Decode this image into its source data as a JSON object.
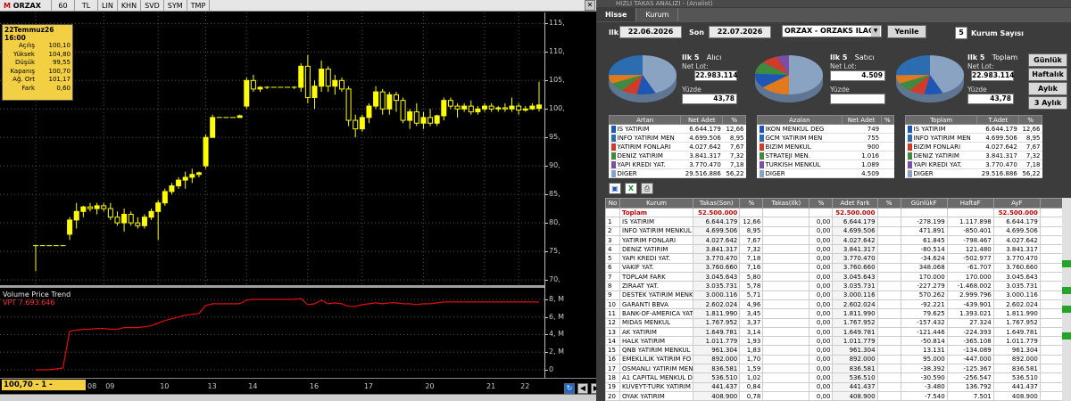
{
  "chart": {
    "symbol": "ORZAX",
    "tb_interval": "60",
    "tb_tl": "TL",
    "tb_modes": [
      "LIN",
      "KHN",
      "SVD",
      "SYM",
      "TMP"
    ],
    "info": {
      "title": "22Temmuz26 16:00",
      "rows": [
        {
          "k": "Açılış",
          "v": "100,10"
        },
        {
          "k": "Yüksek",
          "v": "104,80"
        },
        {
          "k": "Düşük",
          "v": "99,55"
        },
        {
          "k": "Kapanış",
          "v": "100,70"
        },
        {
          "k": "Ağ. Ort",
          "v": "101,17"
        },
        {
          "k": "Fark",
          "v": "0,60"
        }
      ]
    },
    "yticks": [
      "115,",
      "110,",
      "105,",
      "100,",
      "95,",
      "90,",
      "85,",
      "80,",
      "75,",
      "70,"
    ],
    "vpt_title": "Volume Price Trend",
    "vpt_value": "VPT   7.693.646",
    "vpt_ticks": [
      "8, M",
      "6, M",
      "4, M",
      "2, M",
      "0"
    ],
    "xticks": [
      "08",
      "09",
      "10",
      "13",
      "14",
      "16",
      "17",
      "20",
      "21",
      "22"
    ],
    "status": "100,70 - 1 - 16:33:08"
  },
  "chart_data": {
    "type": "candlestick",
    "title": "ORZAX",
    "ylim": [
      70,
      116
    ],
    "days": [
      "08",
      "09",
      "10",
      "13",
      "14",
      "16",
      "17",
      "20",
      "21",
      "22"
    ],
    "colors": {
      "candle": "#ffff00",
      "vpt": "#e01010",
      "grid": "#555555"
    },
    "candles": [
      {
        "o": 76,
        "h": 76,
        "l": 71.5,
        "c": 76
      },
      {
        "o": 76,
        "h": 76,
        "l": 76,
        "c": 76
      },
      {
        "o": 76,
        "h": 76,
        "l": 76,
        "c": 76
      },
      {
        "o": 76,
        "h": 76,
        "l": 76,
        "c": 76
      },
      {
        "o": 76,
        "h": 76,
        "l": 76,
        "c": 76
      },
      {
        "o": 78,
        "h": 81,
        "l": 77,
        "c": 80.5
      },
      {
        "o": 80.5,
        "h": 83.5,
        "l": 79,
        "c": 82
      },
      {
        "o": 82,
        "h": 83,
        "l": 81,
        "c": 82.8
      },
      {
        "o": 82.8,
        "h": 83.5,
        "l": 82,
        "c": 82.5
      },
      {
        "o": 82.5,
        "h": 83.5,
        "l": 81.5,
        "c": 83
      },
      {
        "o": 83,
        "h": 83.5,
        "l": 82,
        "c": 82.5
      },
      {
        "o": 82.5,
        "h": 83.5,
        "l": 80.5,
        "c": 81
      },
      {
        "o": 81,
        "h": 82,
        "l": 79.5,
        "c": 80
      },
      {
        "o": 80,
        "h": 82.5,
        "l": 78.5,
        "c": 81.5
      },
      {
        "o": 81.5,
        "h": 82,
        "l": 79.5,
        "c": 80
      },
      {
        "o": 80,
        "h": 81,
        "l": 79,
        "c": 79.5
      },
      {
        "o": 79.5,
        "h": 81.5,
        "l": 79,
        "c": 81
      },
      {
        "o": 81,
        "h": 82.5,
        "l": 80.5,
        "c": 82
      },
      {
        "o": 82,
        "h": 84,
        "l": 77,
        "c": 83.5
      },
      {
        "o": 83.5,
        "h": 86,
        "l": 83,
        "c": 85.5
      },
      {
        "o": 85.5,
        "h": 87,
        "l": 85,
        "c": 86.5
      },
      {
        "o": 86.5,
        "h": 88,
        "l": 86,
        "c": 87.5
      },
      {
        "o": 87.5,
        "h": 89,
        "l": 86,
        "c": 88
      },
      {
        "o": 88,
        "h": 89.5,
        "l": 87,
        "c": 88.5
      },
      {
        "o": 88.5,
        "h": 89,
        "l": 88,
        "c": 88.8
      },
      {
        "o": 90,
        "h": 95.5,
        "l": 89.5,
        "c": 95
      },
      {
        "o": 95,
        "h": 99,
        "l": 95,
        "c": 98.5
      },
      {
        "o": 98.5,
        "h": 98.5,
        "l": 98.5,
        "c": 98.5
      },
      {
        "o": 98.5,
        "h": 98.5,
        "l": 98.5,
        "c": 98.5
      },
      {
        "o": 98.5,
        "h": 98.5,
        "l": 98.5,
        "c": 98.5
      },
      {
        "o": 98.5,
        "h": 99,
        "l": 98.5,
        "c": 98.8
      },
      {
        "o": 100.5,
        "h": 105.5,
        "l": 100,
        "c": 105
      },
      {
        "o": 105,
        "h": 106,
        "l": 103,
        "c": 103.5
      },
      {
        "o": 103.5,
        "h": 104,
        "l": 103,
        "c": 103.8
      },
      {
        "o": 103.8,
        "h": 104,
        "l": 103.5,
        "c": 103.8
      },
      {
        "o": 103.8,
        "h": 103.8,
        "l": 103.8,
        "c": 103.8
      },
      {
        "o": 103.8,
        "h": 103.8,
        "l": 103.8,
        "c": 103.8
      },
      {
        "o": 103.8,
        "h": 103.8,
        "l": 103.8,
        "c": 103.8
      },
      {
        "o": 103.8,
        "h": 104,
        "l": 103.5,
        "c": 103.8
      },
      {
        "o": 103.8,
        "h": 108,
        "l": 103,
        "c": 107.5
      },
      {
        "o": 107.5,
        "h": 109.5,
        "l": 101,
        "c": 102
      },
      {
        "o": 102,
        "h": 105,
        "l": 100,
        "c": 104
      },
      {
        "o": 104,
        "h": 108.5,
        "l": 103,
        "c": 107
      },
      {
        "o": 107,
        "h": 107.5,
        "l": 103,
        "c": 104
      },
      {
        "o": 104,
        "h": 106,
        "l": 102.5,
        "c": 105
      },
      {
        "o": 105,
        "h": 105.5,
        "l": 103,
        "c": 103.5
      },
      {
        "o": 103.5,
        "h": 104,
        "l": 97,
        "c": 98
      },
      {
        "o": 98,
        "h": 99,
        "l": 95,
        "c": 96.5
      },
      {
        "o": 96.5,
        "h": 99,
        "l": 96,
        "c": 98.5
      },
      {
        "o": 98.5,
        "h": 101,
        "l": 97.5,
        "c": 100.5
      },
      {
        "o": 100.5,
        "h": 104,
        "l": 100,
        "c": 103
      },
      {
        "o": 103,
        "h": 103.5,
        "l": 99,
        "c": 100
      },
      {
        "o": 100,
        "h": 103,
        "l": 99,
        "c": 102.5
      },
      {
        "o": 102.5,
        "h": 103,
        "l": 99.5,
        "c": 101.5
      },
      {
        "o": 101.5,
        "h": 102,
        "l": 97.5,
        "c": 98
      },
      {
        "o": 98,
        "h": 100,
        "l": 96.5,
        "c": 99.5
      },
      {
        "o": 99.5,
        "h": 101,
        "l": 97,
        "c": 97.5
      },
      {
        "o": 97.5,
        "h": 99.5,
        "l": 96.5,
        "c": 98.5
      },
      {
        "o": 98.5,
        "h": 100,
        "l": 97,
        "c": 97.5
      },
      {
        "o": 97.5,
        "h": 99,
        "l": 97,
        "c": 98.8
      },
      {
        "o": 98.8,
        "h": 102,
        "l": 98,
        "c": 101.5
      },
      {
        "o": 101.5,
        "h": 102,
        "l": 100,
        "c": 100.5
      },
      {
        "o": 100.5,
        "h": 101,
        "l": 98.5,
        "c": 100
      },
      {
        "o": 100,
        "h": 101,
        "l": 99.5,
        "c": 100.5
      },
      {
        "o": 100.5,
        "h": 101.5,
        "l": 99,
        "c": 99.5
      },
      {
        "o": 99.5,
        "h": 100.5,
        "l": 99,
        "c": 100
      },
      {
        "o": 100,
        "h": 101,
        "l": 99.5,
        "c": 100.5
      },
      {
        "o": 100.5,
        "h": 101,
        "l": 99.5,
        "c": 100
      },
      {
        "o": 100,
        "h": 100.5,
        "l": 99.5,
        "c": 100.2
      },
      {
        "o": 100.2,
        "h": 101,
        "l": 99.5,
        "c": 100
      },
      {
        "o": 100,
        "h": 102,
        "l": 99.5,
        "c": 100.5
      },
      {
        "o": 100.5,
        "h": 101,
        "l": 99,
        "c": 99.8
      },
      {
        "o": 99.8,
        "h": 100.5,
        "l": 99.5,
        "c": 100
      },
      {
        "o": 100,
        "h": 101,
        "l": 99.8,
        "c": 100.5
      },
      {
        "o": 100.1,
        "h": 104.8,
        "l": 99.55,
        "c": 100.7
      }
    ],
    "vpt_values": [
      0,
      0,
      0,
      0.1,
      0.2,
      4.4,
      4.5,
      4.6,
      4.6,
      4.7,
      4.7,
      4.6,
      4.6,
      4.8,
      4.8,
      4.8,
      4.9,
      5.0,
      5.3,
      5.6,
      5.8,
      6.0,
      6.2,
      6.3,
      6.4,
      7.3,
      7.5,
      7.5,
      7.5,
      7.5,
      7.5,
      7.9,
      8.0,
      8.0,
      8.0,
      8.0,
      8.0,
      8.0,
      8.0,
      8.1,
      7.4,
      7.5,
      7.9,
      7.5,
      7.6,
      7.5,
      7.2,
      7.2,
      7.4,
      7.5,
      7.6,
      7.5,
      7.6,
      7.6,
      7.5,
      7.5,
      7.4,
      7.5,
      7.5,
      7.6,
      7.7,
      7.7,
      7.7,
      7.7,
      7.7,
      7.7,
      7.7,
      7.7,
      7.7,
      7.7,
      7.7,
      7.7,
      7.7,
      7.7,
      7.69
    ]
  },
  "panel": {
    "title": "HIZLI TAKAS ANALIZI - (Analist)",
    "tabs": [
      "Hisse",
      "Kurum"
    ],
    "ilk_label": "Ilk",
    "ilk_date": "22.06.2026",
    "son_label": "Son",
    "son_date": "22.07.2026",
    "symbol_select": "ORZAX - ORZAKS ILAC",
    "refresh": "Yenile",
    "kurum_count": "5",
    "kurum_label": "Kurum Sayısı",
    "period_buttons": [
      "Günlük",
      "Haftalık",
      "Aylık",
      "3 Aylık"
    ],
    "groups": [
      {
        "title": "Ilk 5",
        "sub": "Alıcı",
        "netlot_label": "Net Lot:",
        "netlot": "22.983.114",
        "yuzde_label": "Yüzde",
        "yuzde": "43,78",
        "slices": [
          43.78,
          8.95,
          7.67,
          7.32,
          7.18,
          25.1
        ],
        "colors": [
          "#8aa3c2",
          "#1e56b5",
          "#d03b2a",
          "#3f8a3f",
          "#e07a1c",
          "#2b6db0"
        ]
      },
      {
        "title": "Ilk 5",
        "sub": "Satıcı",
        "netlot_label": "Net Lot:",
        "netlot": "4.509",
        "yuzde_label": "Yüzde",
        "yuzde": "",
        "slices": [
          50,
          14,
          12,
          10,
          8,
          6
        ],
        "colors": [
          "#8aa3c2",
          "#e07a1c",
          "#1e56b5",
          "#3f8a3f",
          "#d03b2a",
          "#7a4ea0"
        ]
      },
      {
        "title": "Ilk 5",
        "sub": "Toplam",
        "netlot_label": "Net Lot:",
        "netlot": "22.983.114",
        "yuzde_label": "Yüzde",
        "yuzde": "43,78",
        "slices": [
          43.78,
          8.95,
          7.67,
          7.32,
          7.18,
          25.1
        ],
        "colors": [
          "#8aa3c2",
          "#1e56b5",
          "#d03b2a",
          "#3f8a3f",
          "#e07a1c",
          "#2b6db0"
        ]
      }
    ],
    "artan": {
      "headers": [
        "Artan",
        "Net Adet",
        "%"
      ],
      "rows": [
        {
          "name": "IS YATIRIM",
          "v": "6.644.179",
          "p": "12,66",
          "c": "#1e56b5"
        },
        {
          "name": "INFO YATIRIM MEN",
          "v": "4.699.506",
          "p": "8,95",
          "c": "#2b6db0"
        },
        {
          "name": "YATIRIM FONLARI",
          "v": "4.027.642",
          "p": "7,67",
          "c": "#d03b2a"
        },
        {
          "name": "DENIZ YATIRIM",
          "v": "3.841.317",
          "p": "7,32",
          "c": "#3f8a3f"
        },
        {
          "name": "YAPI KREDI YAT.",
          "v": "3.770.470",
          "p": "7,18",
          "c": "#7a4ea0"
        },
        {
          "name": "DIGER",
          "v": "29.516.886",
          "p": "56,22",
          "c": "#8aa3c2"
        }
      ]
    },
    "azalan": {
      "headers": [
        "Azalan",
        "Net Adet",
        "%"
      ],
      "rows": [
        {
          "name": "IKON MENKUL DEG",
          "v": "749",
          "p": "",
          "c": "#1e56b5"
        },
        {
          "name": "GCM YATIRIM MEN",
          "v": "755",
          "p": "",
          "c": "#2b6db0"
        },
        {
          "name": "BIZIM MENKUL",
          "v": "900",
          "p": "",
          "c": "#d03b2a"
        },
        {
          "name": "STRATEJI MEN.",
          "v": "1.016",
          "p": "",
          "c": "#3f8a3f"
        },
        {
          "name": "TURKISH MENKUL",
          "v": "1.089",
          "p": "",
          "c": "#7a4ea0"
        },
        {
          "name": "DIGER",
          "v": "4.509",
          "p": "",
          "c": "#8aa3c2"
        }
      ]
    },
    "toplam": {
      "headers": [
        "Toplam",
        "T.Adet",
        "%"
      ],
      "rows": [
        {
          "name": "IS YATIRIM",
          "v": "6.644.179",
          "p": "12,66",
          "c": "#1e56b5"
        },
        {
          "name": "INFO YATIRIM MEN",
          "v": "4.699.506",
          "p": "8,95",
          "c": "#2b6db0"
        },
        {
          "name": "BIZIM FONLARI",
          "v": "4.027.642",
          "p": "7,67",
          "c": "#d03b2a"
        },
        {
          "name": "DENIZ YATIRIM",
          "v": "3.841.317",
          "p": "7,32",
          "c": "#3f8a3f"
        },
        {
          "name": "YAPI KREDI YAT.",
          "v": "3.770.470",
          "p": "7,18",
          "c": "#7a4ea0"
        },
        {
          "name": "DIGER",
          "v": "29.516.886",
          "p": "56,22",
          "c": "#8aa3c2"
        }
      ]
    },
    "big": {
      "headers": [
        "No",
        "Kurum",
        "Takas(Son)",
        "%",
        "Takas(Ilk)",
        "%",
        "Adet Fark",
        "%",
        "GünlükF",
        "HaftaF",
        "AyF",
        ""
      ],
      "total": {
        "no": "",
        "name": "Toplam",
        "ts": "52.500.000",
        "tsp": "",
        "ti": "",
        "tip": "",
        "af": "52.500.000",
        "afp": "",
        "g": "",
        "h": "",
        "a": "52.500.000",
        "x": "52."
      },
      "rows": [
        [
          "1",
          "IS YATIRIM",
          "6.644.179",
          "12,66",
          "",
          "0,00",
          "6.644.179",
          "",
          "-278.199",
          "1.117.898",
          "6.644.179",
          "1"
        ],
        [
          "2",
          "INFO YATIRIM MENKUL",
          "4.699.506",
          "8,95",
          "",
          "0,00",
          "4.699.506",
          "",
          "471.891",
          "-850.401",
          "4.699.506",
          "4."
        ],
        [
          "3",
          "YATIRIM FONLARI",
          "4.027.642",
          "7,67",
          "",
          "0,00",
          "4.027.642",
          "",
          "61.845",
          "-798.467",
          "4.027.642",
          "4."
        ],
        [
          "4",
          "DENIZ YATIRIM",
          "3.841.317",
          "7,32",
          "",
          "0,00",
          "3.841.317",
          "",
          "-80.514",
          "121.480",
          "3.841.317",
          "3."
        ],
        [
          "5",
          "YAPI KREDI YAT.",
          "3.770.470",
          "7,18",
          "",
          "0,00",
          "3.770.470",
          "",
          "-34.624",
          "-502.977",
          "3.770.470",
          "3."
        ],
        [
          "6",
          "VAKIF YAT.",
          "3.760.660",
          "7,16",
          "",
          "0,00",
          "3.760.660",
          "",
          "348.068",
          "-61.707",
          "3.760.660",
          "3."
        ],
        [
          "7",
          "TOPLAM FARK",
          "3.045.643",
          "5,80",
          "",
          "0,00",
          "3.045.643",
          "",
          "170.000",
          "170.000",
          "3.045.643",
          "3."
        ],
        [
          "8",
          "ZIRAAT YAT.",
          "3.035.731",
          "5,78",
          "",
          "0,00",
          "3.035.731",
          "",
          "-227.279",
          "-1.468.002",
          "3.035.731",
          "3."
        ],
        [
          "9",
          "DESTEK YATIRIM MENK",
          "3.000.116",
          "5,71",
          "",
          "0,00",
          "3.000.116",
          "",
          "570.262",
          "2.999.796",
          "3.000.116",
          "3."
        ],
        [
          "10",
          "GARANTI BBVA",
          "2.602.024",
          "4,96",
          "",
          "0,00",
          "2.602.024",
          "",
          "-92.221",
          "-439.901",
          "2.602.024",
          "2."
        ],
        [
          "11",
          "BANK-OF-AMERICA YAT",
          "1.811.990",
          "3,45",
          "",
          "0,00",
          "1.811.990",
          "",
          "79.625",
          "1.393.021",
          "1.811.990",
          "1."
        ],
        [
          "12",
          "MIDAS MENKUL",
          "1.767.952",
          "3,37",
          "",
          "0,00",
          "1.767.952",
          "",
          "-157.432",
          "27.324",
          "1.767.952",
          "1."
        ],
        [
          "13",
          "AK YATIRIM",
          "1.649.781",
          "3,14",
          "",
          "0,00",
          "1.649.781",
          "",
          "-121.446",
          "-224.393",
          "1.649.781",
          "1."
        ],
        [
          "14",
          "HALK YATIRIM",
          "1.011.779",
          "1,93",
          "",
          "0,00",
          "1.011.779",
          "",
          "-50.814",
          "-365.108",
          "1.011.779",
          "1."
        ],
        [
          "15",
          "QNB YATIRIM MENKUL",
          "961.304",
          "1,83",
          "",
          "0,00",
          "961.304",
          "",
          "13.131",
          "-134.089",
          "961.304",
          ""
        ],
        [
          "16",
          "EMEKLILIK YATIRIM FO",
          "892.000",
          "1,70",
          "",
          "0,00",
          "892.000",
          "",
          "95.000",
          "-447.000",
          "892.000",
          ""
        ],
        [
          "17",
          "OSMANLI YATIRIM MEN",
          "836.581",
          "1,59",
          "",
          "0,00",
          "836.581",
          "",
          "-38.392",
          "-125.367",
          "836.581",
          ""
        ],
        [
          "18",
          "A1 CAPITAL MENKUL DE",
          "536.510",
          "1,02",
          "",
          "0,00",
          "536.510",
          "",
          "-30.590",
          "-256.547",
          "536.510",
          ""
        ],
        [
          "19",
          "KUVEYT-TURK YATIRIM",
          "441.437",
          "0,84",
          "",
          "0,00",
          "441.437",
          "",
          "-3.480",
          "136.792",
          "441.437",
          ""
        ],
        [
          "20",
          "OYAK YATIRIM",
          "408.900",
          "0,78",
          "",
          "0,00",
          "408.900",
          "",
          "-7.540",
          "7.501",
          "408.900",
          ""
        ],
        [
          "21",
          "TACIRLER YAT.",
          "390.094",
          "0,74",
          "",
          "0,00",
          "390.094",
          "",
          "52.040",
          "110.643",
          "390.094",
          ""
        ]
      ]
    }
  }
}
